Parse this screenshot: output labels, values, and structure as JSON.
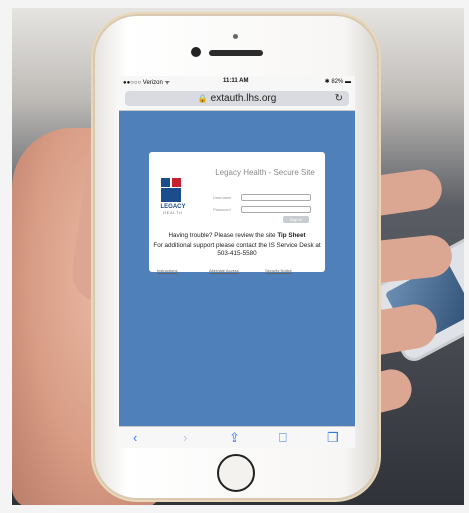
{
  "status_bar": {
    "carrier": "●●○○○ Verizon ᯤ",
    "time": "11:11 AM",
    "battery": "✱ 82% ▬"
  },
  "browser": {
    "url": "extauth.lhs.org",
    "lock_icon": "lock-icon",
    "reload_icon": "↻"
  },
  "login": {
    "logo_text": "LEGACY",
    "logo_sub": "HEALTH",
    "title": "Legacy Health - Secure Site",
    "username_label": "Username",
    "password_label": "Password",
    "signin_label": "Sign In",
    "help_prefix": "Having trouble? Please review the site ",
    "help_link": "Tip Sheet",
    "support_text": "For additional support please contact the IS Service Desk at 503-415-5580",
    "footer_links": [
      "Instructions",
      "Alternate Access",
      "Security Notice"
    ]
  },
  "toolbar": {
    "back": "‹",
    "forward": "›",
    "share": "⇪",
    "bookmarks": "⎕",
    "tabs": "❐"
  },
  "colors": {
    "page_background": "#4f80b9",
    "accent": "#2f7ae5"
  }
}
